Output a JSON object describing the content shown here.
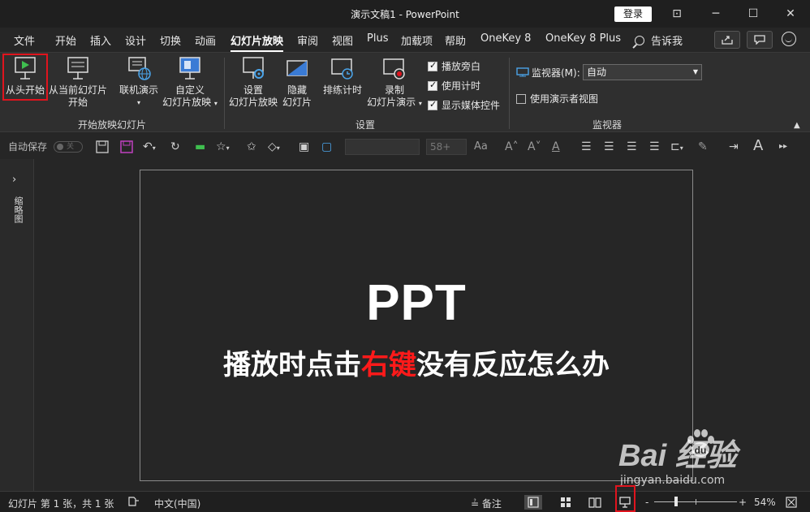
{
  "titlebar": {
    "title": "演示文稿1  -  PowerPoint",
    "login_label": "登录",
    "restore_label": "⊡",
    "minimize_label": "─",
    "maximize_label": "☐",
    "close_label": "✕"
  },
  "menu": {
    "tabs": [
      "文件",
      "开始",
      "插入",
      "设计",
      "切换",
      "动画",
      "幻灯片放映",
      "审阅",
      "视图",
      "Plus",
      "加载项",
      "帮助",
      "OneKey 8",
      "OneKey 8 Plus"
    ],
    "active_tab": "幻灯片放映",
    "search_label": "告诉我"
  },
  "ribbon": {
    "groups": {
      "start": {
        "label": "开始放映幻灯片",
        "buttons": {
          "from_beginning": "从头开始",
          "from_current_line1": "从当前幻灯片",
          "from_current_line2": "开始",
          "online_line1": "联机演示",
          "custom_line1": "自定义",
          "custom_line2": "幻灯片放映"
        }
      },
      "setup": {
        "label": "设置",
        "buttons": {
          "setup_line1": "设置",
          "setup_line2": "幻灯片放映",
          "hide_line1": "隐藏",
          "hide_line2": "幻灯片",
          "rehearse": "排练计时",
          "record_line1": "录制",
          "record_line2": "幻灯片演示"
        },
        "checkboxes": [
          {
            "label": "播放旁白",
            "checked": true
          },
          {
            "label": "使用计时",
            "checked": true
          },
          {
            "label": "显示媒体控件",
            "checked": true
          }
        ]
      },
      "monitors": {
        "label": "监视器",
        "monitor_label": "监视器(M):",
        "monitor_value": "自动",
        "presenter_view_label": "使用演示者视图",
        "presenter_view_checked": false
      }
    }
  },
  "qat": {
    "autosave_label": "自动保存",
    "autosave_state": "关",
    "font_size": "58+",
    "font_scale_label": "Aa"
  },
  "thumbnails": {
    "label": "缩略图"
  },
  "slide": {
    "title": "PPT",
    "subtitle_before": "播放时点击",
    "subtitle_highlight": "右键",
    "subtitle_after": "没有反应怎么办",
    "highlight_color": "#ff1a1a"
  },
  "watermark": {
    "brand": "Bai  经验",
    "url": "jingyan.baidu.com"
  },
  "status": {
    "slide_info": "幻灯片 第 1 张，共 1 张",
    "language": "中文(中国)",
    "notes_label": "备注",
    "zoom_level": "54%",
    "zoom_minus": "-",
    "zoom_plus": "+"
  },
  "colors": {
    "accent_red": "#e0141e",
    "background": "#262626"
  }
}
